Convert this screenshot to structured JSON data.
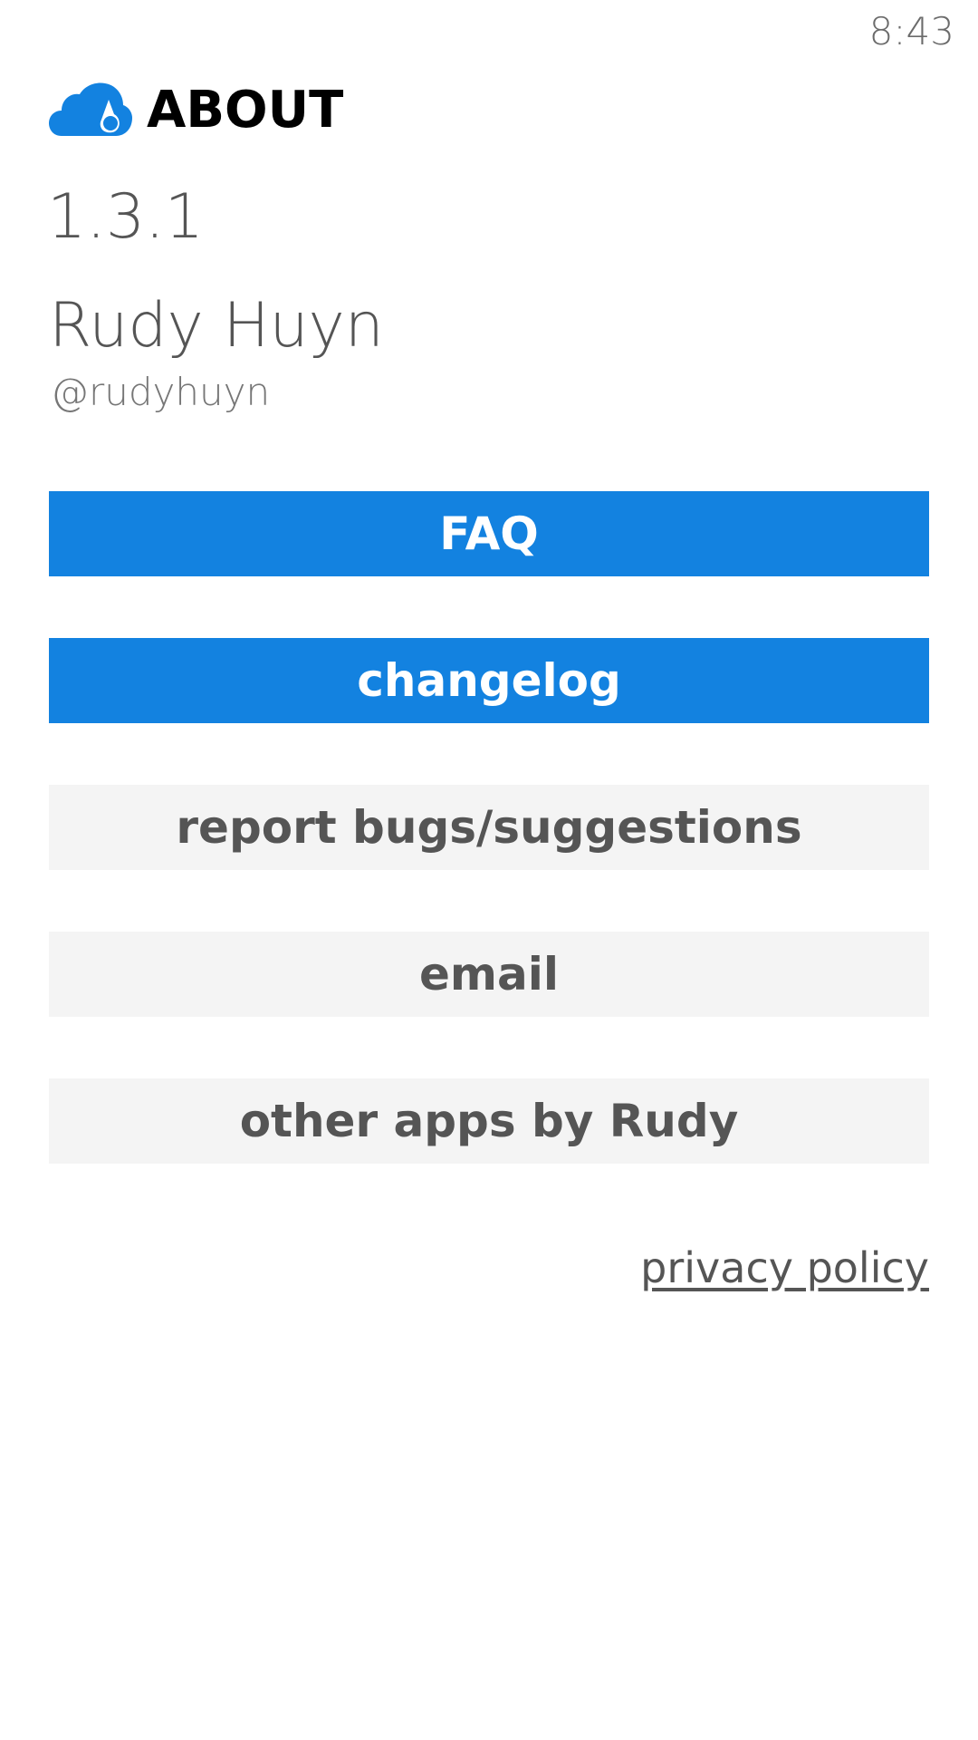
{
  "status_bar": {
    "time": "8:43"
  },
  "header": {
    "logo_icon": "cloud-drop-icon",
    "title": "ABOUT"
  },
  "app_info": {
    "version": "1.3.1",
    "author_name": "Rudy Huyn",
    "author_handle": "@rudyhuyn"
  },
  "buttons": {
    "faq": "FAQ",
    "changelog": "changelog",
    "report": "report bugs/suggestions",
    "email": "email",
    "other_apps": "other apps by Rudy"
  },
  "links": {
    "privacy_policy": "privacy policy"
  },
  "colors": {
    "accent": "#1382e0",
    "secondary_button_bg": "#f4f4f4",
    "text_gray": "#555555"
  }
}
